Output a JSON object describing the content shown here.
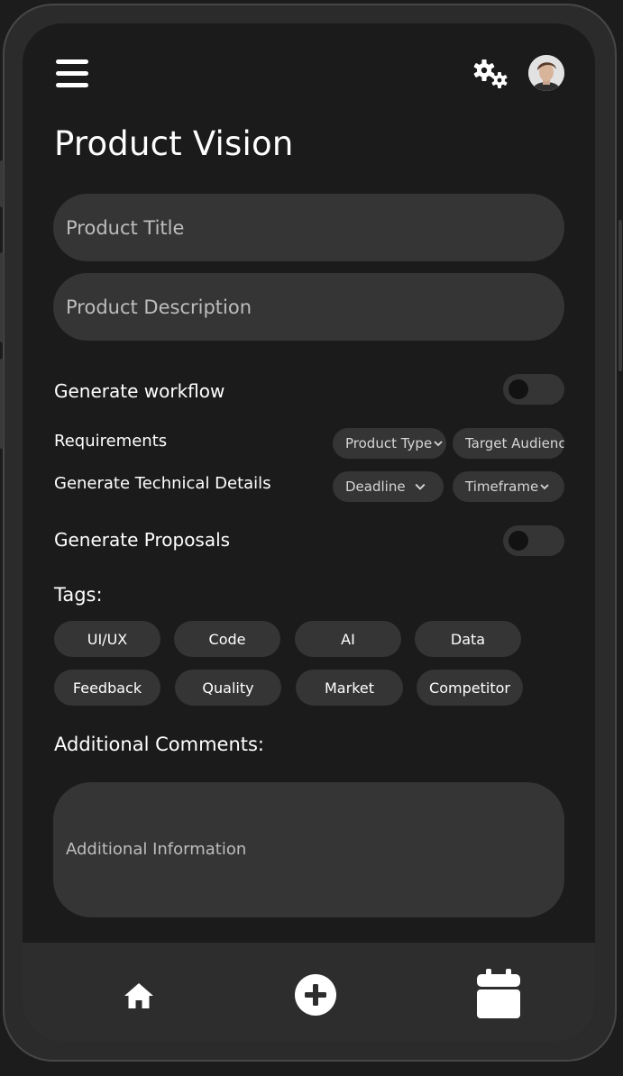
{
  "header": {
    "menu_icon": "hamburger-menu-icon",
    "settings_icon": "gears-icon",
    "avatar_icon": "user-avatar"
  },
  "page": {
    "title": "Product Vision"
  },
  "form": {
    "product_title_placeholder": "Product Title",
    "product_description_placeholder": "Product Description",
    "generate_workflow_label": "Generate workflow",
    "requirements_label": "Requirements",
    "tech_details_label": "Generate Technical Details",
    "proposals_label": "Generate Proposals",
    "dropdowns": {
      "product_type": "Product Type",
      "target_audience": "Target Audience",
      "deadline": "Deadline",
      "timeframe": "Timeframe"
    },
    "tags_label": "Tags:",
    "tags": [
      "UI/UX",
      "Code",
      "AI",
      "Data",
      "Feedback",
      "Quality",
      "Market",
      "Competitor"
    ],
    "comments_label": "Additional Comments:",
    "comments_placeholder": "Additional Information"
  },
  "toggles": {
    "generate_workflow": false,
    "generate_proposals": false
  },
  "bottom_nav": {
    "home_icon": "home-icon",
    "add_icon": "plus-circle-icon",
    "calendar_icon": "calendar-icon"
  },
  "colors": {
    "background": "#1b1b1b",
    "surface": "#353535",
    "nav_bar": "#2d2d2d",
    "text": "#ffffff",
    "placeholder": "#bdbdbd"
  }
}
